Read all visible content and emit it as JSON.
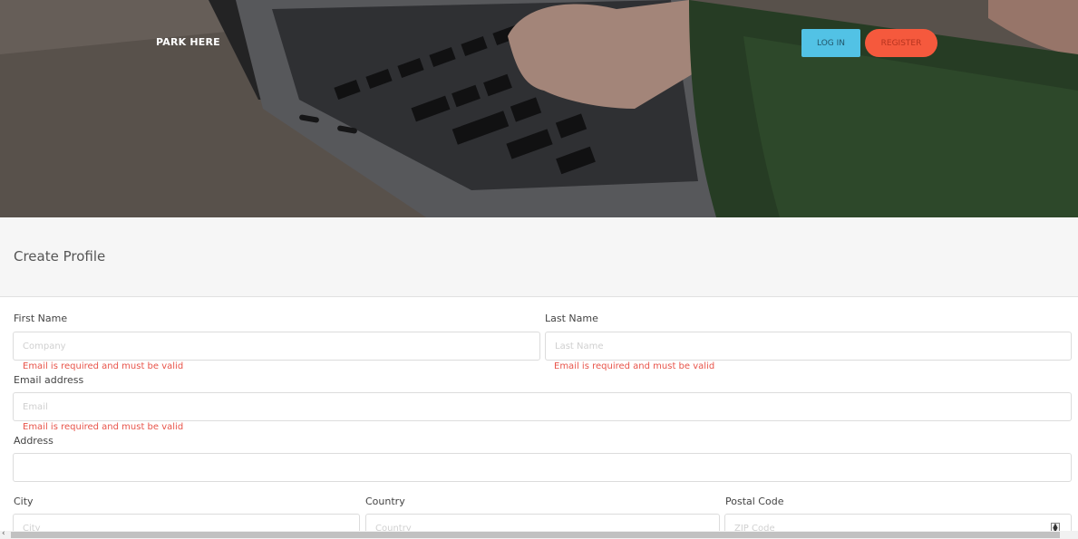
{
  "header": {
    "brand": "PARK HERE",
    "login_label": "LOG IN",
    "register_label": "REGISTER"
  },
  "page": {
    "title": "Create Profile"
  },
  "form": {
    "first_name": {
      "label": "First Name",
      "placeholder": "Company",
      "value": "",
      "error": "Email is required and must be valid"
    },
    "last_name": {
      "label": "Last Name",
      "placeholder": "Last Name",
      "value": "",
      "error": "Email is required and must be valid"
    },
    "email": {
      "label": "Email address",
      "placeholder": "Email",
      "value": "",
      "error": "Email is required and must be valid"
    },
    "address": {
      "label": "Address",
      "placeholder": "",
      "value": ""
    },
    "city": {
      "label": "City",
      "placeholder": "City",
      "value": ""
    },
    "country": {
      "label": "Country",
      "placeholder": "Country",
      "value": ""
    },
    "postal_code": {
      "label": "Postal Code",
      "placeholder": "ZIP Code",
      "value": ""
    }
  },
  "colors": {
    "login_button": "#52c2e5",
    "register_button": "#f5593d",
    "error_text": "#e8544a"
  }
}
